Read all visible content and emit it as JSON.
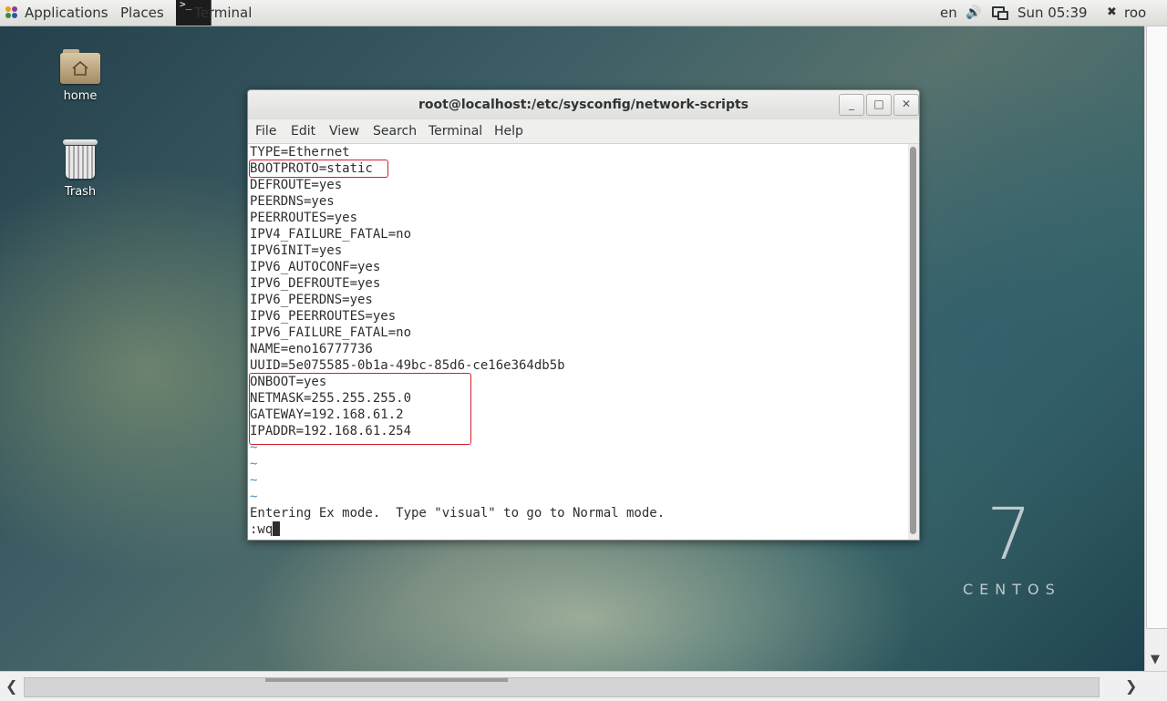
{
  "top_panel": {
    "applications": "Applications",
    "places": "Places",
    "taskbar_terminal": "Terminal",
    "language": "en",
    "clock": "Sun 05:39",
    "user": "roo"
  },
  "desktop": {
    "icons": [
      {
        "label": "home"
      },
      {
        "label": "Trash"
      }
    ],
    "branding_number": "7",
    "branding_word": "CENTOS"
  },
  "window": {
    "title": "root@localhost:/etc/sysconfig/network-scripts",
    "menu": [
      "File",
      "Edit",
      "View",
      "Search",
      "Terminal",
      "Help"
    ],
    "lines": [
      "TYPE=Ethernet",
      "BOOTPROTO=static",
      "DEFROUTE=yes",
      "PEERDNS=yes",
      "PEERROUTES=yes",
      "IPV4_FAILURE_FATAL=no",
      "IPV6INIT=yes",
      "IPV6_AUTOCONF=yes",
      "IPV6_DEFROUTE=yes",
      "IPV6_PEERDNS=yes",
      "IPV6_PEERROUTES=yes",
      "IPV6_FAILURE_FATAL=no",
      "NAME=eno16777736",
      "UUID=5e075585-0b1a-49bc-85d6-ce16e364db5b",
      "ONBOOT=yes",
      "NETMASK=255.255.255.0",
      "GATEWAY=192.168.61.2",
      "IPADDR=192.168.61.254"
    ],
    "tildes": [
      "~",
      "~",
      "~",
      "~"
    ],
    "ex_message": "Entering Ex mode.  Type \"visual\" to go to Normal mode.",
    "command": ":wq"
  },
  "colors": {
    "highlight_box": "#d0202a",
    "tilde": "#4a8ec2"
  }
}
